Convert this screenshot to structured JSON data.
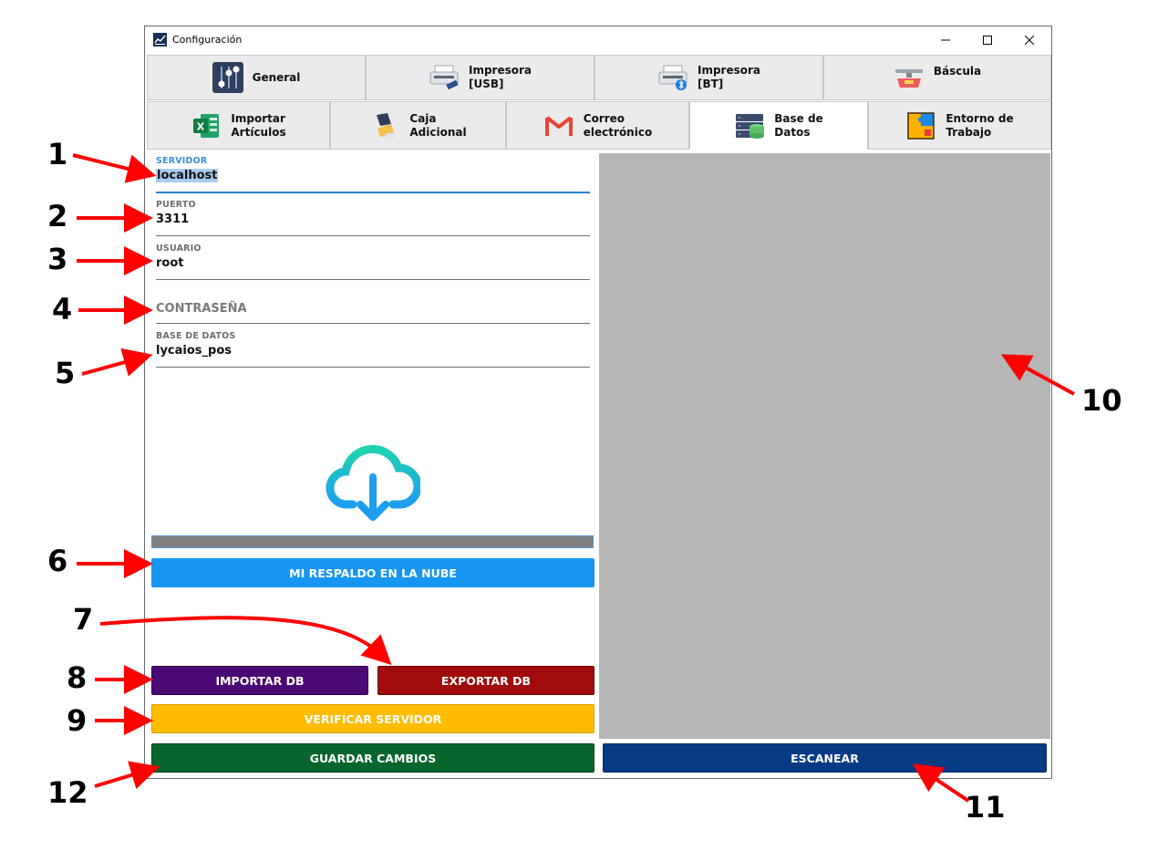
{
  "window": {
    "title": "Configuración",
    "controls": {
      "minimize": "—",
      "maximize": "☐",
      "close": "✕"
    }
  },
  "tabs_row1": [
    {
      "label": "General",
      "icon": "sliders-icon"
    },
    {
      "label": "Impresora\n[USB]",
      "icon": "usb-printer-icon"
    },
    {
      "label": "Impresora\n[BT]",
      "icon": "bluetooth-printer-icon"
    },
    {
      "label": "Báscula",
      "icon": "scale-icon"
    }
  ],
  "tabs_row2": [
    {
      "label": "Importar\nArtículos",
      "icon": "excel-icon"
    },
    {
      "label": "Caja\nAdicional",
      "icon": "cash-register-icon"
    },
    {
      "label": "Correo\nelectrónico",
      "icon": "gmail-icon"
    },
    {
      "label": "Base de\nDatos",
      "icon": "database-icon",
      "active": true
    },
    {
      "label": "Entorno de\nTrabajo",
      "icon": "puzzle-icon"
    }
  ],
  "form": {
    "server": {
      "label": "SERVIDOR",
      "value": "localhost"
    },
    "port": {
      "label": "PUERTO",
      "value": "3311"
    },
    "user": {
      "label": "USUARIO",
      "value": "root"
    },
    "password": {
      "placeholder": "CONTRASEÑA",
      "value": ""
    },
    "database": {
      "label": "BASE DE DATOS",
      "value": "lycaios_pos"
    }
  },
  "cloud_icon": "cloud-download-icon",
  "progress": {
    "value": 0
  },
  "buttons": {
    "cloud_backup": "MI RESPALDO EN LA NUBE",
    "import_db": "IMPORTAR DB",
    "export_db": "EXPORTAR DB",
    "verify_server": "VERIFICAR SERVIDOR",
    "save_changes": "GUARDAR CAMBIOS",
    "scan": "ESCANEAR"
  },
  "colors": {
    "cloud_backup": "#1696f0",
    "import_db": "#4b0a73",
    "export_db": "#a10b0b",
    "verify_server": "#ffbc00",
    "save_changes": "#07662b",
    "scan": "#053a85",
    "annotation_arrow": "#ff0000"
  },
  "annotations": [
    "1",
    "2",
    "3",
    "4",
    "5",
    "6",
    "7",
    "8",
    "9",
    "10",
    "11",
    "12"
  ]
}
